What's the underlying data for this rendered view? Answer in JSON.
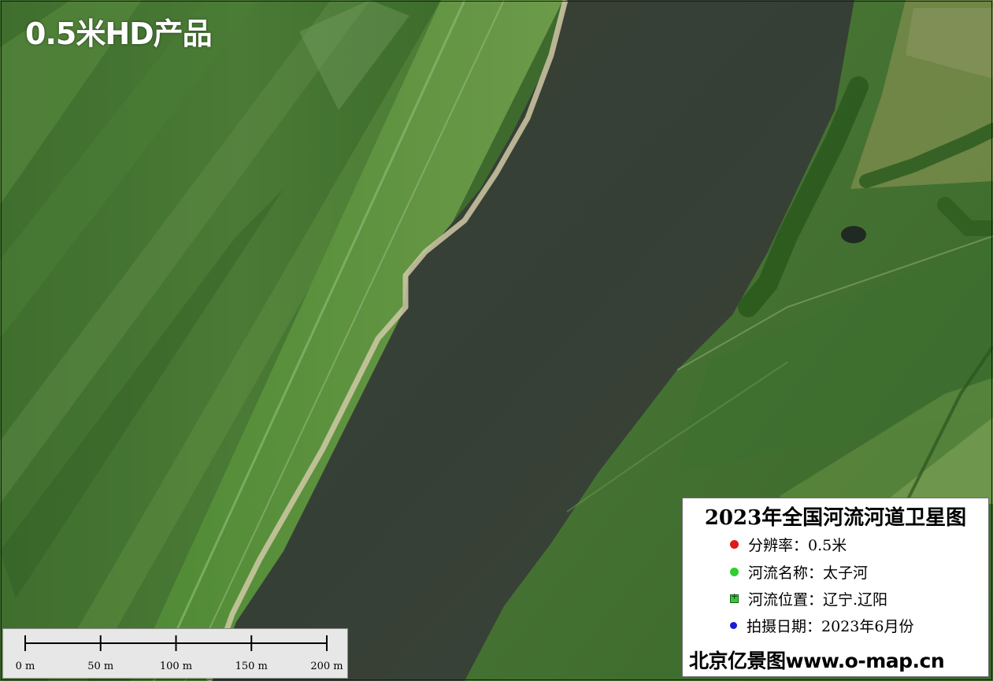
{
  "map": {
    "product_label": "0.5米HD产品",
    "scale_bar": {
      "ticks": [
        "0 m",
        "50 m",
        "100 m",
        "150 m",
        "200 m"
      ]
    },
    "legend": {
      "title": "2023年全国河流河道卫星图",
      "items": [
        {
          "text": "分辨率：0.5米",
          "marker": "red-dot-icon",
          "color": "#e01818"
        },
        {
          "text": "河流名称：太子河",
          "marker": "green-dot-icon",
          "color": "#2ccf2c"
        },
        {
          "text": "河流位置：辽宁.辽阳",
          "marker": "green-square-marker-icon",
          "color": "#33cc33"
        },
        {
          "text": "拍摄日期：2023年6月份",
          "marker": "blue-dot-icon",
          "color": "#1a1ad8"
        }
      ],
      "credit": "北京亿景图www.o-map.cn"
    },
    "colors": {
      "water": "#3a4236",
      "field_dark": "#3d6a2c",
      "field_light": "#5a8a3e",
      "riverbank_sand": "#cfc9a4"
    }
  }
}
